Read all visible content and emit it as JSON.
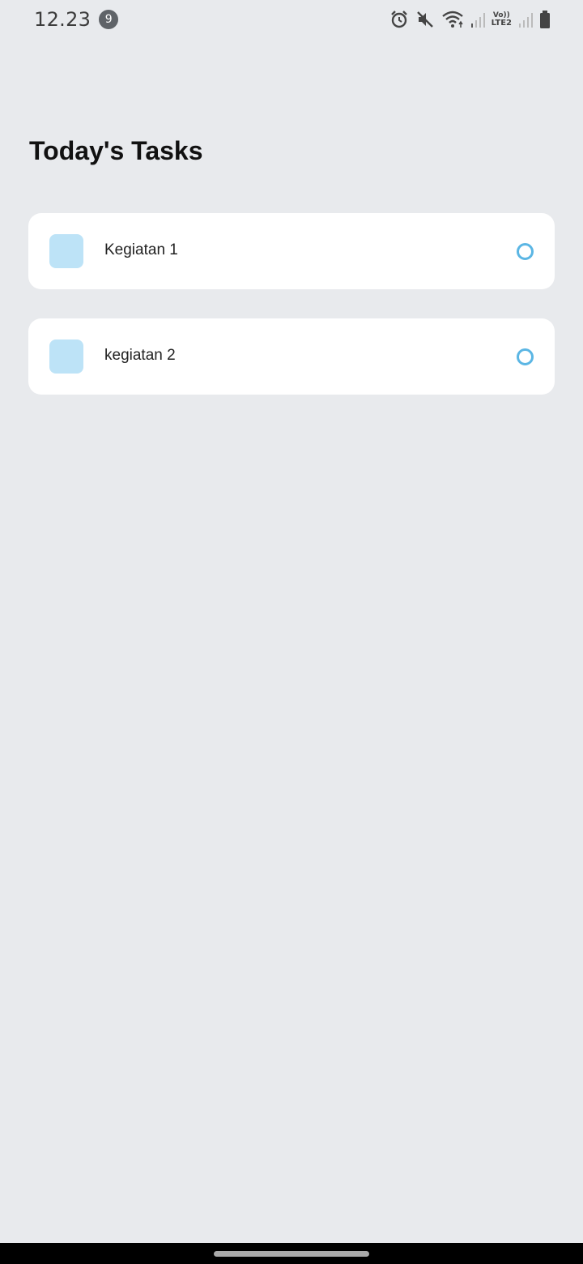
{
  "status_bar": {
    "time": "12.23",
    "notification_count": "9",
    "network_label_top": "Vo))",
    "network_label_bottom": "LTE2",
    "icons": [
      "alarm-icon",
      "mute-icon",
      "wifi-icon",
      "signal-icon",
      "volte-lte2-icon",
      "signal-icon",
      "battery-icon"
    ]
  },
  "page": {
    "title": "Today's Tasks"
  },
  "tasks": [
    {
      "label": "Kegiatan 1",
      "completed": false
    },
    {
      "label": "kegiatan 2",
      "completed": false
    }
  ],
  "colors": {
    "background": "#e8eaed",
    "card": "#ffffff",
    "task_square": "#bde3f7",
    "check_ring": "#5bb6e4"
  }
}
